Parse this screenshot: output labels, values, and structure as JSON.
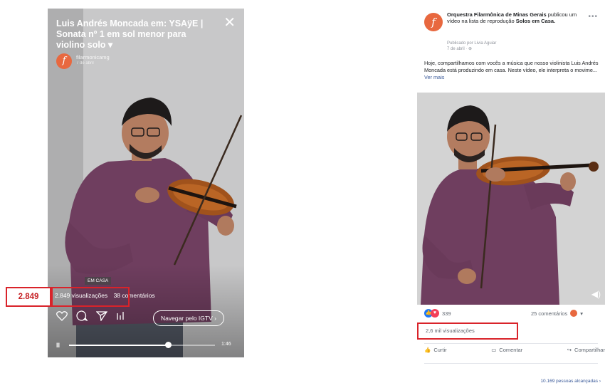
{
  "igtv": {
    "title": "Luis Andrés Moncada em: YSAÿE | Sonata nº 1 em sol menor para violino solo ▾",
    "account": "filarmonicamg",
    "date": "7 de abril",
    "tag": "EM CASA",
    "views": "2.849 visualizações",
    "comments": "38 comentários",
    "igtv_button": "Navegar pelo IGTV ›",
    "pause_glyph": "II",
    "time": "1:46",
    "progress": 0.68,
    "callout": "2.849",
    "icons": [
      "close-icon",
      "heart-icon",
      "comment-icon",
      "send-icon",
      "equalizer-icon"
    ]
  },
  "facebook": {
    "page_name": "Orquestra Filarmônica de Minas Gerais",
    "action": "publicou um vídeo na lista de reprodução",
    "playlist": "Solos em Casa.",
    "published_by": "Publicado por Livia Aguiar",
    "date": "7 de abril · ",
    "post_text": "Hoje, compartilhamos com vocês a música que nosso violinista Luis Andrés Moncada está produzindo em casa. Neste vídeo, ele interpreta o movime... ",
    "see_more": "Ver mais",
    "reaction_count": "339",
    "comment_count": "25 comentários",
    "views": "2,6 mil visualizações",
    "like_label": "Curtir",
    "comment_label": "Comentar",
    "share_label": "Compartilhar",
    "reach": "10.169 pessoas alcançadas ›"
  },
  "colors": {
    "callout_red": "#d9232a",
    "brand_orange": "#e8683f",
    "fb_blue": "#2078f4",
    "shirt_purple": "#6f3e5f"
  }
}
